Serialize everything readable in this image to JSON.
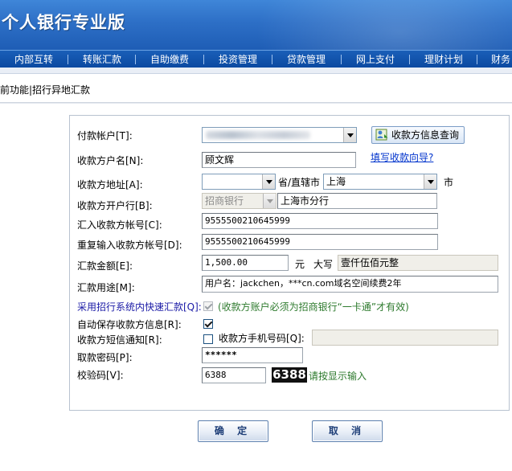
{
  "app": {
    "title": "个人银行专业版"
  },
  "nav": {
    "items": [
      {
        "label": "内部互转"
      },
      {
        "label": "转账汇款"
      },
      {
        "label": "自助缴费"
      },
      {
        "label": "投资管理"
      },
      {
        "label": "贷款管理"
      },
      {
        "label": "网上支付"
      },
      {
        "label": "理财计划"
      },
      {
        "label": "财务"
      }
    ]
  },
  "breadcrumb": "前功能|招行异地汇款",
  "form": {
    "payer_account": {
      "label": "付款帐户[T]:",
      "value": ""
    },
    "query_button_label": "收款方信息查询",
    "payee_name": {
      "label": "收款方户名[N]:",
      "value": "顾文辉"
    },
    "payee_wizard_link": "填写收款向导?",
    "payee_address": {
      "label": "收款方地址[A]:",
      "province_value": "",
      "province_suffix": "省/直辖市",
      "city_value": "上海",
      "city_suffix": "市"
    },
    "payee_bank": {
      "label": "收款方开户行[B]:",
      "bank_value": "招商银行",
      "branch_value": "上海市分行"
    },
    "payee_account": {
      "label": "汇入收款方帐号[C]:",
      "value": "9555500210645999"
    },
    "payee_account_repeat": {
      "label": "重复输入收款方帐号[D]:",
      "value": "9555500210645999"
    },
    "amount": {
      "label": "汇款金额[E]:",
      "value": "1,500.00",
      "unit": "元",
      "uppercase_label": "大写",
      "uppercase_value": "壹仟伍佰元整"
    },
    "purpose": {
      "label": "汇款用途[M]:",
      "value": "用户名：jackchen，***cn.com域名空间续费2年"
    },
    "fast_remit": {
      "label": "采用招行系统内快速汇款[Q]:",
      "checked": true,
      "note": "(收款方账户必须为招商银行“一卡通”才有效)"
    },
    "auto_save": {
      "label": "自动保存收款方信息[R]:",
      "checked": true
    },
    "sms_notify": {
      "label": "收款方短信通知[R]:",
      "checked": false,
      "phone_label": "收款方手机号码[Q]:",
      "phone_value": ""
    },
    "password": {
      "label": "取款密码[P]:",
      "value": "******"
    },
    "captcha": {
      "label": "校验码[V]:",
      "value": "6388",
      "image_text": "6388",
      "hint": "请按显示输入"
    }
  },
  "buttons": {
    "confirm": "确 定",
    "cancel": "取 消"
  },
  "colors": {
    "banner": "#2d6fc6",
    "nav": "#0b4aa1",
    "link": "#0033cc",
    "fast_remit_label": "#1a1aa6",
    "note_green": "#2d7a2d"
  },
  "icons": {
    "query": "user-search-icon",
    "dropdown": "chevron-down-icon"
  }
}
